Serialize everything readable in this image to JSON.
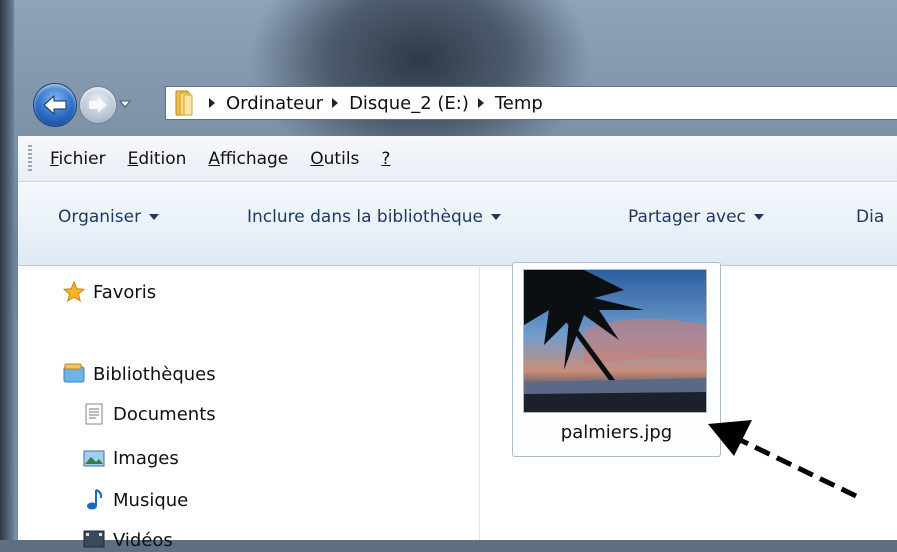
{
  "address": {
    "crumbs": [
      "Ordinateur",
      "Disque_2 (E:)",
      "Temp"
    ]
  },
  "menubar": {
    "items": [
      {
        "mnemonic": "F",
        "rest": "ichier"
      },
      {
        "mnemonic": "E",
        "rest": "dition"
      },
      {
        "mnemonic": "A",
        "rest": "ffichage"
      },
      {
        "mnemonic": "O",
        "rest": "utils"
      },
      {
        "mnemonic": "?",
        "rest": ""
      }
    ]
  },
  "commandbar": {
    "organiser": "Organiser",
    "inclure": "Inclure dans la bibliothèque",
    "partager": "Partager avec",
    "diaporama": "Dia"
  },
  "navpane": {
    "favoris": "Favoris",
    "bibliotheques": "Bibliothèques",
    "documents": "Documents",
    "images": "Images",
    "musique": "Musique",
    "videos": "Vidéos"
  },
  "content": {
    "file_name": "palmiers.jpg"
  },
  "colors": {
    "accent_blue": "#2a6bc5",
    "command_text": "#1e395b",
    "arrow": "#000000"
  }
}
